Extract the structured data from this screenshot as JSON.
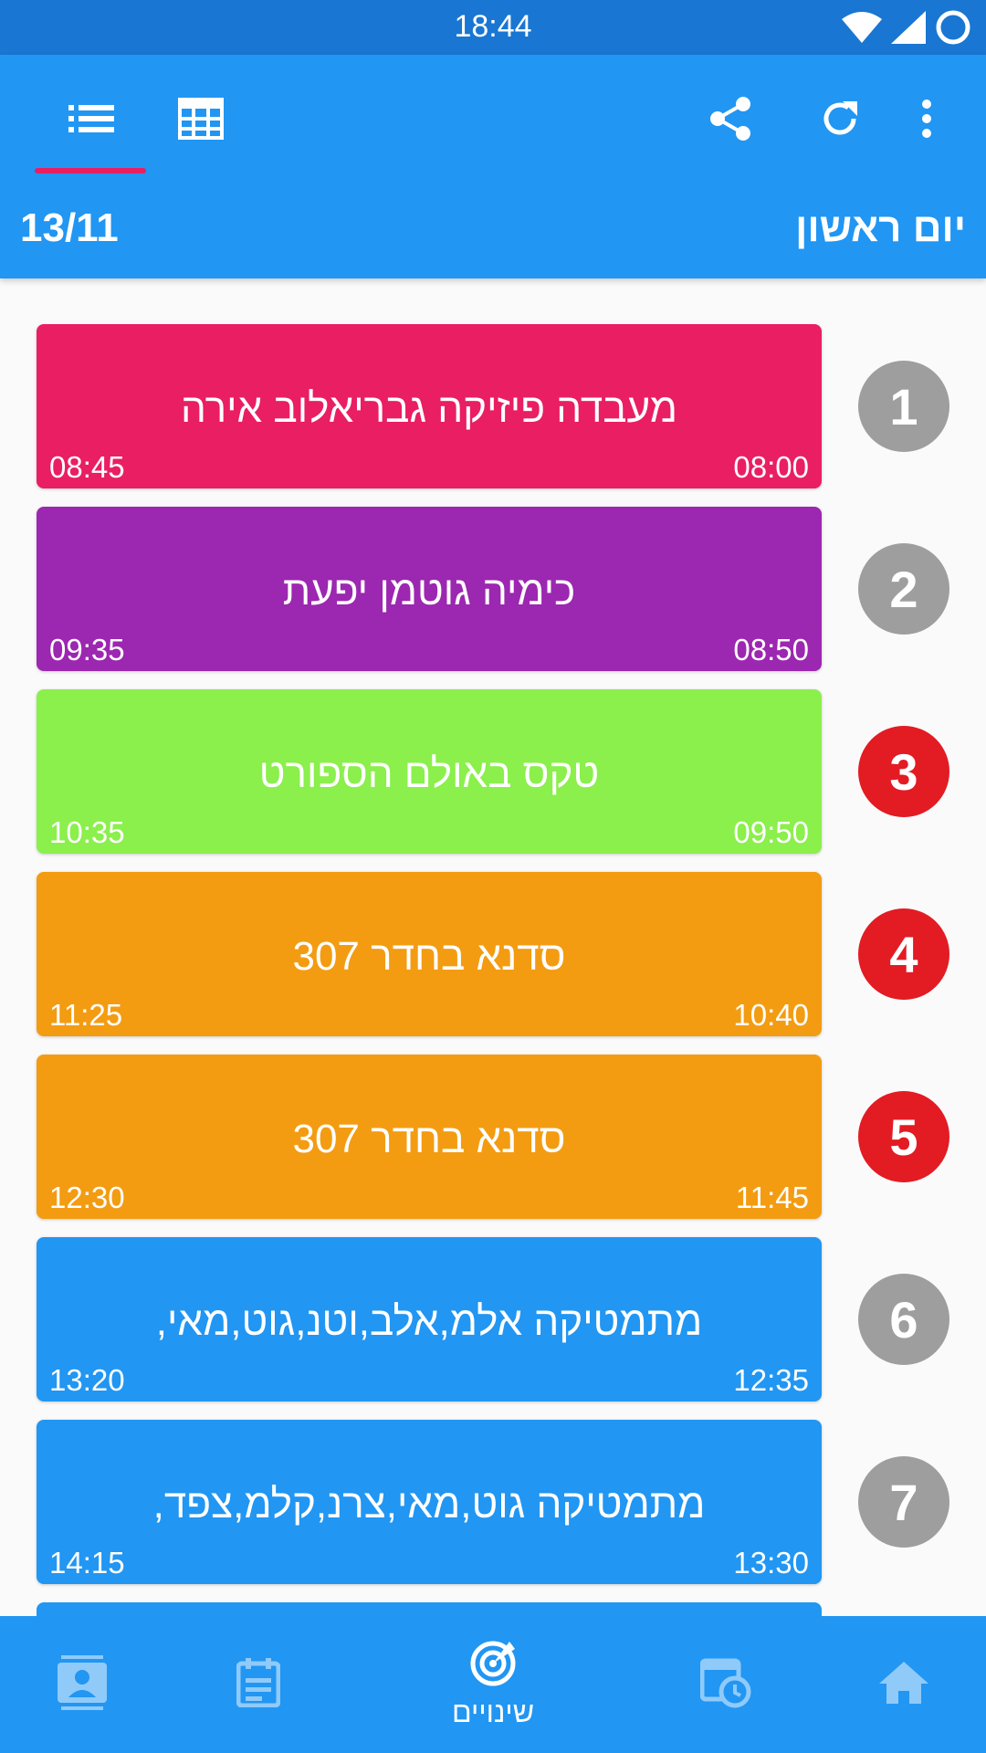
{
  "status_bar": {
    "time": "18:44",
    "icons": [
      "wifi-icon",
      "signal-icon",
      "dnd-ring-icon"
    ]
  },
  "toolbar": {
    "tabs": [
      {
        "name": "list-view-icon",
        "active": true
      },
      {
        "name": "grid-view-icon",
        "active": false
      }
    ],
    "actions": [
      "share-icon",
      "refresh-icon",
      "more-vert-icon"
    ],
    "date": "13/11",
    "day": "יום ראשון",
    "accent_color": "#E91E63",
    "primary_color": "#2196F3",
    "dark_primary_color": "#1976D2"
  },
  "lessons": [
    {
      "number": "1",
      "title": "מעבדה פיזיקה גבריאלוב אירה",
      "start": "08:00",
      "end": "08:45",
      "color": "#E91E63",
      "circle_color": "#9E9E9E"
    },
    {
      "number": "2",
      "title": "כימיה גוטמן יפעת",
      "start": "08:50",
      "end": "09:35",
      "color": "#9C27B0",
      "circle_color": "#9E9E9E"
    },
    {
      "number": "3",
      "title": "טקס באולם הספורט",
      "start": "09:50",
      "end": "10:35",
      "color": "#8BEF4C",
      "circle_color": "#E31B23"
    },
    {
      "number": "4",
      "title": "סדנא בחדר 307",
      "start": "10:40",
      "end": "11:25",
      "color": "#F39C12",
      "circle_color": "#E31B23"
    },
    {
      "number": "5",
      "title": "סדנא בחדר 307",
      "start": "11:45",
      "end": "12:30",
      "color": "#F39C12",
      "circle_color": "#E31B23"
    },
    {
      "number": "6",
      "title": "מתמטיקה אלמ,אלב,וטנ,גוט,מאי,",
      "start": "12:35",
      "end": "13:20",
      "color": "#2196F3",
      "circle_color": "#9E9E9E"
    },
    {
      "number": "7",
      "title": "מתמטיקה גוט,מאי,צרנ,קלמ,צפד,",
      "start": "13:30",
      "end": "14:15",
      "color": "#2196F3",
      "circle_color": "#9E9E9E"
    }
  ],
  "bottom_nav": {
    "items": [
      {
        "name": "contacts-icon",
        "label": ""
      },
      {
        "name": "calendar-icon",
        "label": ""
      },
      {
        "name": "changes-radar-icon",
        "label": "שינויים"
      },
      {
        "name": "schedule-clock-icon",
        "label": ""
      },
      {
        "name": "home-icon",
        "label": ""
      }
    ]
  }
}
